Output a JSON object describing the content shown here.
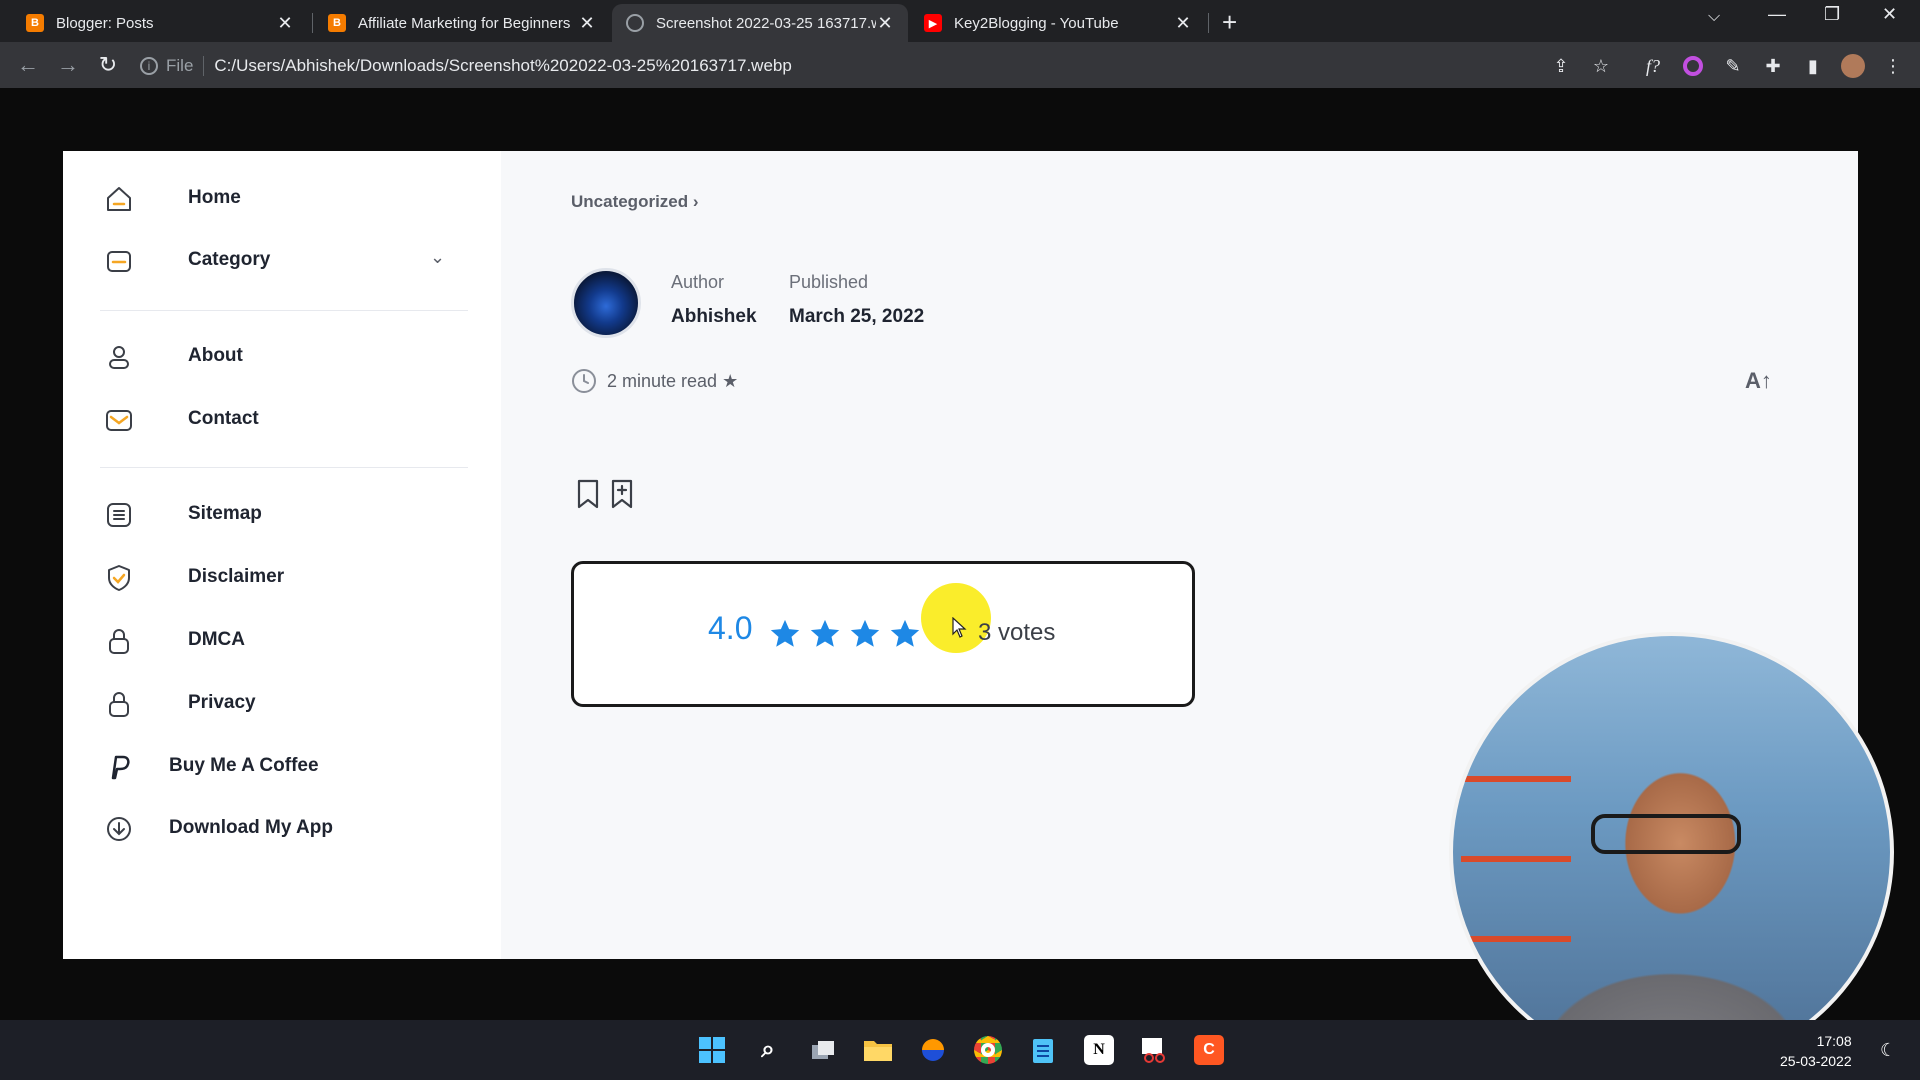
{
  "browser": {
    "tabs": [
      {
        "label": "Blogger: Posts"
      },
      {
        "label": "Affiliate Marketing for Beginners"
      },
      {
        "label": "Screenshot 2022-03-25 163717.w"
      },
      {
        "label": "Key2Blogging - YouTube"
      }
    ],
    "address": {
      "scheme_label": "File",
      "url": "C:/Users/Abhishek/Downloads/Screenshot%202022-03-25%20163717.webp"
    }
  },
  "sidebar": {
    "items": [
      {
        "label": "Home",
        "icon": "home-icon"
      },
      {
        "label": "Category",
        "icon": "folder-icon"
      },
      {
        "label": "About",
        "icon": "user-icon"
      },
      {
        "label": "Contact",
        "icon": "mail-icon"
      },
      {
        "label": "Sitemap",
        "icon": "list-icon"
      },
      {
        "label": "Disclaimer",
        "icon": "shield-icon"
      },
      {
        "label": "DMCA",
        "icon": "lock-icon"
      },
      {
        "label": "Privacy",
        "icon": "lock-icon"
      },
      {
        "label": "Buy Me A Coffee",
        "icon": "paypal-icon"
      },
      {
        "label": "Download My App",
        "icon": "download-icon"
      }
    ]
  },
  "article": {
    "breadcrumb": "Uncategorized ›",
    "author_label": "Author",
    "author_name": "Abhishek",
    "published_label": "Published",
    "published_date": "March 25, 2022",
    "read_time": "2 minute read ★",
    "font_size_toggle": "A↑"
  },
  "rating": {
    "score": "4.0",
    "filled_stars": 4,
    "votes_text": "3 votes",
    "star_color": "#1e88e5"
  },
  "taskbar": {
    "time": "17:08",
    "date": "25-03-2022"
  }
}
